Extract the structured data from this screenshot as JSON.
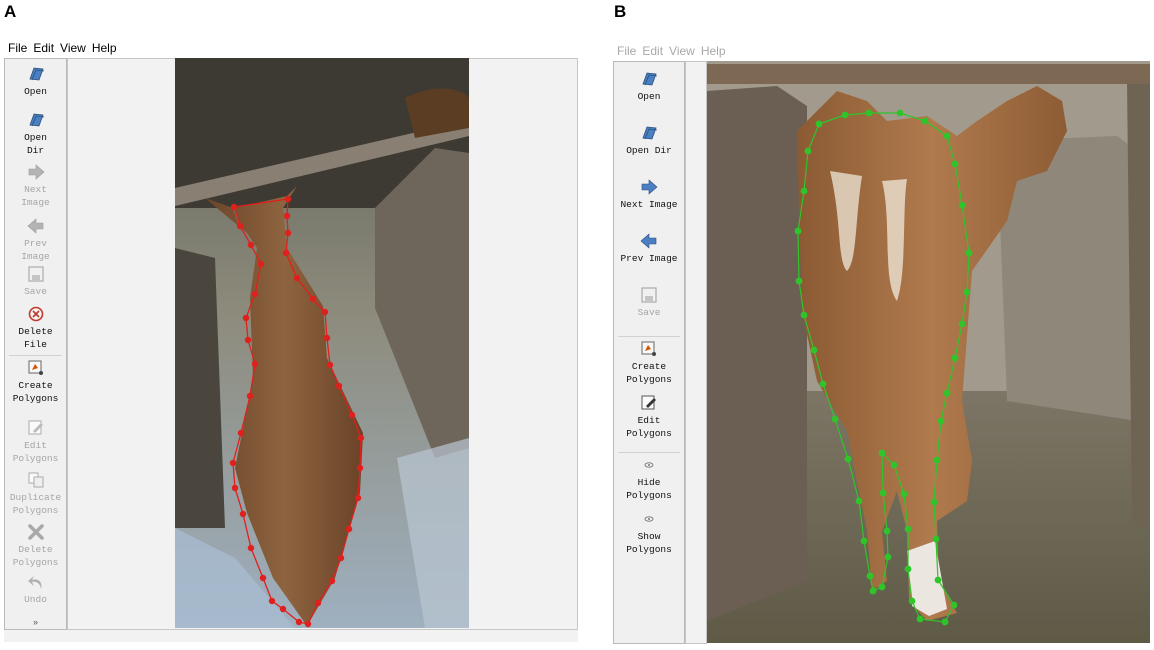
{
  "panel_a": {
    "letter": "A",
    "menu": [
      "File",
      "Edit",
      "View",
      "Help"
    ],
    "tools": [
      {
        "label": "Open",
        "icon": "open-icon",
        "enabled": true
      },
      {
        "label": "Open\nDir",
        "icon": "open-dir-icon",
        "enabled": true
      },
      {
        "label": "Next\nImage",
        "icon": "next-image-icon",
        "enabled": false
      },
      {
        "label": "Prev\nImage",
        "icon": "prev-image-icon",
        "enabled": false
      },
      {
        "label": "Save",
        "icon": "save-icon",
        "enabled": false
      },
      {
        "label": "Delete\nFile",
        "icon": "delete-file-icon",
        "enabled": true
      },
      {
        "label": "Create\nPolygons",
        "icon": "create-polygons-icon",
        "enabled": true
      },
      {
        "label": "Edit\nPolygons",
        "icon": "edit-polygons-icon",
        "enabled": false
      },
      {
        "label": "Duplicate\nPolygons",
        "icon": "duplicate-polygons-icon",
        "enabled": false
      },
      {
        "label": "Delete\nPolygons",
        "icon": "delete-polygons-icon",
        "enabled": false
      },
      {
        "label": "Undo",
        "icon": "undo-icon",
        "enabled": false
      }
    ],
    "more_indicator": "»",
    "annotation_color": "#e0201c"
  },
  "panel_b": {
    "letter": "B",
    "menu": [
      "File",
      "Edit",
      "View",
      "Help"
    ],
    "tools": [
      {
        "label": "Open",
        "icon": "open-icon",
        "enabled": true
      },
      {
        "label": "Open Dir",
        "icon": "open-dir-icon",
        "enabled": true
      },
      {
        "label": "Next Image",
        "icon": "next-image-icon",
        "enabled": true
      },
      {
        "label": "Prev Image",
        "icon": "prev-image-icon",
        "enabled": true
      },
      {
        "label": "Save",
        "icon": "save-icon",
        "enabled": false
      },
      {
        "label": "Create\nPolygons",
        "icon": "create-polygons-icon",
        "enabled": true
      },
      {
        "label": "Edit\nPolygons",
        "icon": "edit-polygons-icon",
        "enabled": true
      },
      {
        "label": "Hide\nPolygons",
        "icon": "hide-polygons-icon",
        "enabled": true
      },
      {
        "label": "Show\nPolygons",
        "icon": "show-polygons-icon",
        "enabled": true
      }
    ],
    "annotation_color": "#2fc52a"
  }
}
